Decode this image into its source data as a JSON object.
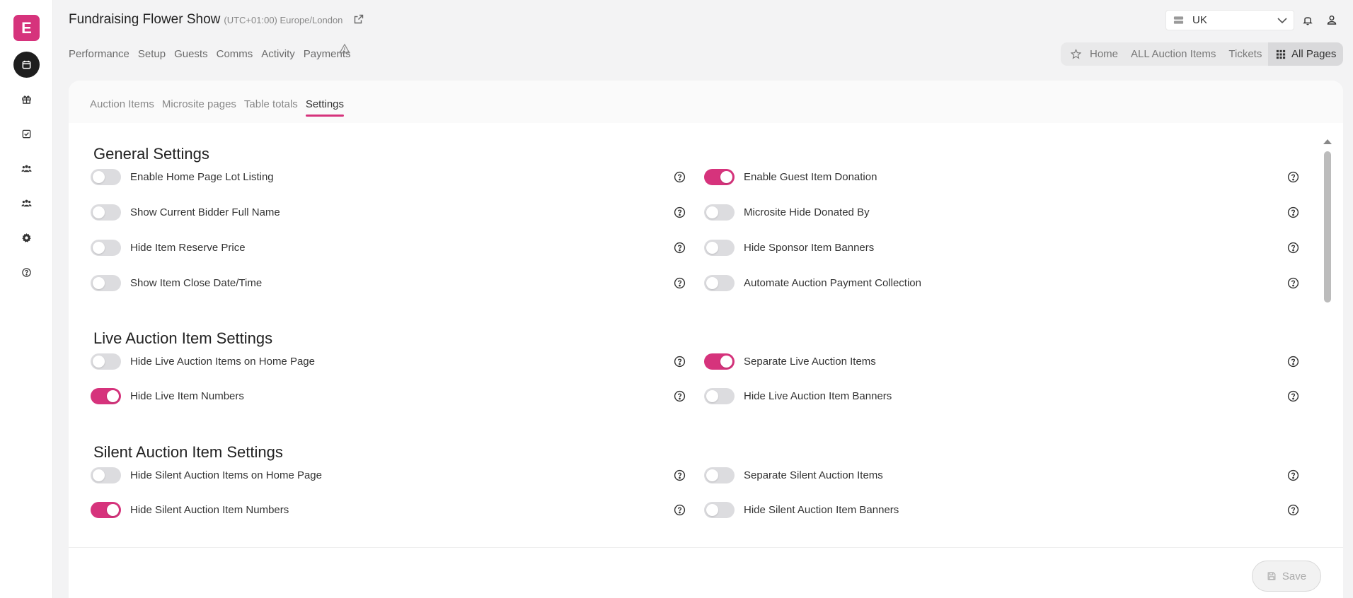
{
  "app": {
    "logo_letter": "E",
    "title": "Fundraising Flower Show",
    "timezone": "(UTC+01:00) Europe/London"
  },
  "nav": {
    "items": [
      "Performance",
      "Setup",
      "Guests",
      "Comms",
      "Activity",
      "Payments"
    ]
  },
  "region": {
    "label": "UK"
  },
  "pagebar": {
    "items": [
      "Home",
      "ALL Auction Items",
      "Tickets"
    ],
    "all_pages": "All Pages"
  },
  "tabs": {
    "items": [
      "Auction Items",
      "Microsite pages",
      "Table totals",
      "Settings"
    ],
    "active": "Settings"
  },
  "sections": {
    "general": {
      "title": "General Settings",
      "left": [
        {
          "label": "Enable Home Page Lot Listing",
          "on": false
        },
        {
          "label": "Show Current Bidder Full Name",
          "on": false
        },
        {
          "label": "Hide Item Reserve Price",
          "on": false
        },
        {
          "label": "Show Item Close Date/Time",
          "on": false
        }
      ],
      "right": [
        {
          "label": "Enable Guest Item Donation",
          "on": true
        },
        {
          "label": "Microsite Hide Donated By",
          "on": false
        },
        {
          "label": "Hide Sponsor Item Banners",
          "on": false
        },
        {
          "label": "Automate Auction Payment Collection",
          "on": false
        }
      ]
    },
    "live": {
      "title": "Live Auction Item Settings",
      "left": [
        {
          "label": "Hide Live Auction Items on Home Page",
          "on": false
        },
        {
          "label": "Hide Live Item Numbers",
          "on": true
        }
      ],
      "right": [
        {
          "label": "Separate Live Auction Items",
          "on": true
        },
        {
          "label": "Hide Live Auction Item Banners",
          "on": false
        }
      ]
    },
    "silent": {
      "title": "Silent Auction Item Settings",
      "left": [
        {
          "label": "Hide Silent Auction Items on Home Page",
          "on": false
        },
        {
          "label": "Hide Silent Auction Item Numbers",
          "on": true
        }
      ],
      "right": [
        {
          "label": "Separate Silent Auction Items",
          "on": false
        },
        {
          "label": "Hide Silent Auction Item Banners",
          "on": false
        }
      ]
    }
  },
  "footer": {
    "save_label": "Save"
  },
  "colors": {
    "accent": "#d6337c",
    "toggle_off": "#dcdcdf"
  }
}
